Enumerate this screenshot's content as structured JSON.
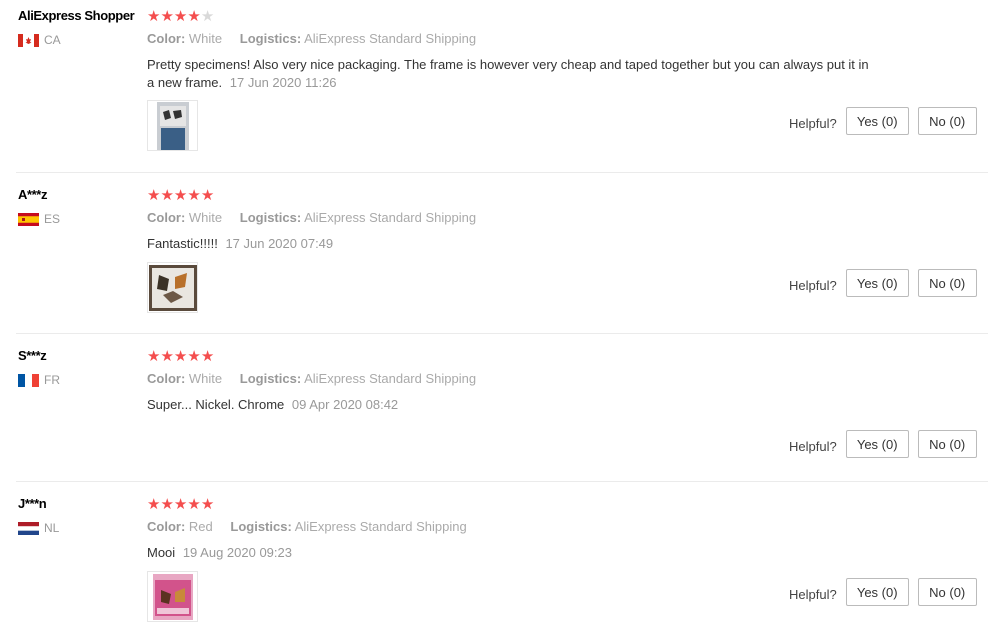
{
  "labels": {
    "color_key": "Color:",
    "logistics_key": "Logistics:",
    "helpful": "Helpful?"
  },
  "reviews": [
    {
      "user": "AliExpress Shopper",
      "country": "CA",
      "flag": "canada-flag-icon",
      "rating": 4,
      "color": "White",
      "logistics": "AliExpress Standard Shipping",
      "text": "Pretty specimens! Also very nice packaging. The frame is however very cheap and taped together but you can always put it in a new frame.",
      "time": "17 Jun 2020 11:26",
      "has_photo": true,
      "yes": "Yes (0)",
      "no": "No (0)"
    },
    {
      "user": "A***z",
      "country": "ES",
      "flag": "spain-flag-icon",
      "rating": 5,
      "color": "White",
      "logistics": "AliExpress Standard Shipping",
      "text": "Fantastic!!!!!",
      "time": "17 Jun 2020 07:49",
      "has_photo": true,
      "yes": "Yes (0)",
      "no": "No (0)"
    },
    {
      "user": "S***z",
      "country": "FR",
      "flag": "france-flag-icon",
      "rating": 5,
      "color": "White",
      "logistics": "AliExpress Standard Shipping",
      "text": "Super... Nickel. Chrome",
      "time": "09 Apr 2020 08:42",
      "has_photo": false,
      "yes": "Yes (0)",
      "no": "No (0)"
    },
    {
      "user": "J***n",
      "country": "NL",
      "flag": "netherlands-flag-icon",
      "rating": 5,
      "color": "Red",
      "logistics": "AliExpress Standard Shipping",
      "text": "Mooi",
      "time": "19 Aug 2020 09:23",
      "has_photo": true,
      "yes": "Yes (0)",
      "no": "No (0)"
    }
  ],
  "colors": {
    "star_on": "#f44e4e",
    "star_off": "#d9d9d9",
    "divider": "#ebebeb"
  }
}
